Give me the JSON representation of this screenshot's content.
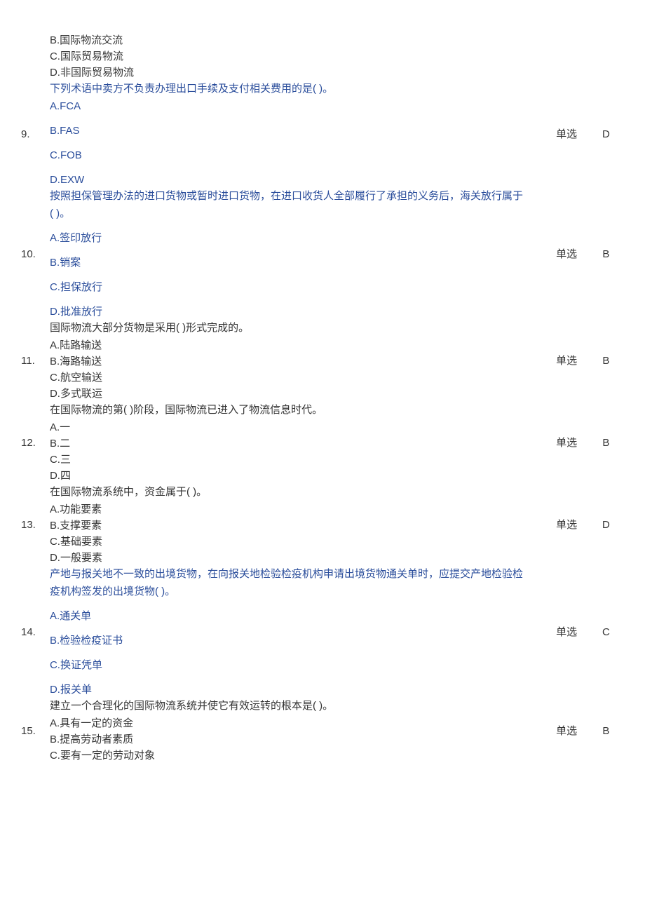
{
  "partial_q8": {
    "options": [
      "B.国际物流交流",
      "C.国际贸易物流",
      "D.非国际贸易物流"
    ]
  },
  "questions": [
    {
      "num": "9.",
      "type": "单选",
      "answer": "D",
      "blueStyle": true,
      "spacedOptions": true,
      "stem": "下列术语中卖方不负责办理出口手续及支付相关费用的是( )。",
      "options": [
        "A.FCA",
        "B.FAS",
        "C.FOB",
        "D.EXW"
      ]
    },
    {
      "num": "10.",
      "type": "单选",
      "answer": "B",
      "blueStyle": true,
      "spacedOptions": true,
      "stemLines": [
        "按照担保管理办法的进口货物或暂时进口货物，在进口收货人全部履行了承担的义务后，海关放行属于",
        "( )。"
      ],
      "options": [
        "A.签印放行",
        "B.销案",
        "C.担保放行",
        "D.批准放行"
      ]
    },
    {
      "num": "11.",
      "type": "单选",
      "answer": "B",
      "blueStyle": false,
      "spacedOptions": false,
      "stem": "国际物流大部分货物是采用( )形式完成的。",
      "options": [
        "A.陆路输送",
        "B.海路输送",
        "C.航空输送",
        "D.多式联运"
      ]
    },
    {
      "num": "12.",
      "type": "单选",
      "answer": "B",
      "blueStyle": false,
      "spacedOptions": false,
      "stem": "在国际物流的第( )阶段，国际物流已进入了物流信息时代。",
      "options": [
        "A.一",
        "B.二",
        "C.三",
        "D.四"
      ]
    },
    {
      "num": "13.",
      "type": "单选",
      "answer": "D",
      "blueStyle": false,
      "spacedOptions": false,
      "stem": "在国际物流系统中，资金属于( )。",
      "options": [
        "A.功能要素",
        "B.支撑要素",
        "C.基础要素",
        "D.一般要素"
      ]
    },
    {
      "num": "14.",
      "type": "单选",
      "answer": "C",
      "blueStyle": true,
      "spacedOptions": true,
      "stemLines": [
        "产地与报关地不一致的出境货物，在向报关地检验检疫机构申请出境货物通关单时，应提交产地检验检",
        "疫机构签发的出境货物( )。"
      ],
      "options": [
        "A.通关单",
        "B.检验检疫证书",
        "C.换证凭单",
        "D.报关单"
      ]
    },
    {
      "num": "15.",
      "type": "单选",
      "answer": "B",
      "blueStyle": false,
      "spacedOptions": false,
      "stem": "建立一个合理化的国际物流系统并使它有效运转的根本是( )。",
      "options": [
        "A.具有一定的资金",
        "B.提高劳动者素质",
        "C.要有一定的劳动对象"
      ]
    }
  ]
}
